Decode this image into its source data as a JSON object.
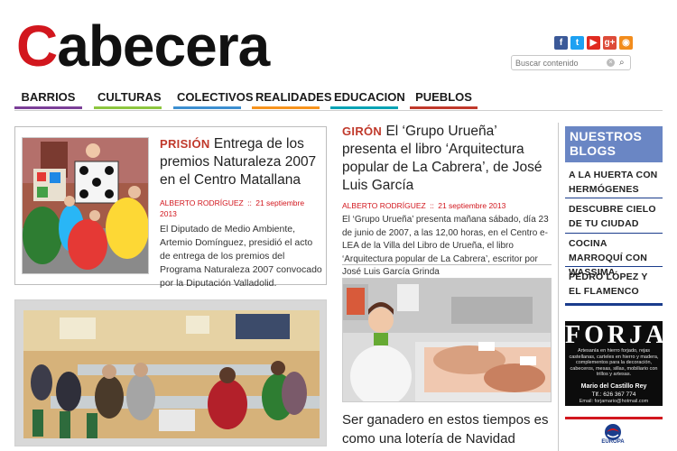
{
  "site": {
    "logo_first": "C",
    "logo_rest": "abecera"
  },
  "social": [
    {
      "name": "facebook-icon",
      "glyph": "f",
      "color": "#3b5998"
    },
    {
      "name": "twitter-icon",
      "glyph": "t",
      "color": "#1da1f2"
    },
    {
      "name": "youtube-icon",
      "glyph": "▶",
      "color": "#e02a20"
    },
    {
      "name": "google-plus-icon",
      "glyph": "g+",
      "color": "#dd4b39"
    },
    {
      "name": "rss-icon",
      "glyph": "◉",
      "color": "#f28c1c"
    }
  ],
  "search": {
    "placeholder": "Buscar contenido"
  },
  "nav": [
    {
      "label": "BARRIOS",
      "color": "#7b3f98"
    },
    {
      "label": "CULTURAS",
      "color": "#8dc63f"
    },
    {
      "label": "COLECTIVOS",
      "color": "#3d8fd1"
    },
    {
      "label": "REALIDADES",
      "color": "#f7941d"
    },
    {
      "label": "EDUCACION",
      "color": "#00a3b4"
    },
    {
      "label": "PUEBLOS",
      "color": "#c0392b"
    }
  ],
  "article1": {
    "kicker": "PRISIÓN",
    "title": "Entrega de los premios Naturaleza 2007 en el Centro Matallana",
    "author": "ALBERTO RODRÍGUEZ",
    "sep": "::",
    "date": "21 septiembre 2013",
    "excerpt": "El Diputado de Medio Ambiente, Artemio Domínguez, presidió el acto de entrega de los premios del Programa Naturaleza 2007 convocado por la Diputación Valladolid."
  },
  "article2": {
    "kicker": "GIRÓN",
    "title": "El ‘Grupo Urueña’ presenta el libro ‘Arquitectura popular de La Cabrera’, de José Luis García",
    "author": "ALBERTO RODRÍGUEZ",
    "sep": "::",
    "date": "21 septiembre 2013",
    "excerpt": "El ‘Grupo Urueña’ presenta mañana sábado, día 23 de junio de 2007, a las 12,00 horas, en el Centro e-LEA de la Villa del Libro de Urueña, el libro ‘Arquitectura popular de La Cabrera’, escritor por José Luis García Grinda"
  },
  "article3": {
    "title": "Ser ganadero en estos tiempos  es como una lotería de Navidad"
  },
  "blogs": {
    "title": "NUESTROS BLOGS",
    "items": [
      "A LA HUERTA CON HERMÓGENES",
      "DESCUBRE CIELO DE TU CIUDAD",
      "COCINA MARROQUÍ CON WASSIMA",
      "PEDRO LÓPEZ Y EL FLAMENCO"
    ]
  },
  "forja": {
    "title": "FORJA",
    "description": "Artesanía en hierro forjado, rejas castellanas, carteles en hierro y madera, complementos para la decoración, cabeceros, mesas, sillas, mobiliario con trillos y artesas.",
    "name": "Mario del Castillo Rey",
    "tel": "Tlf.: 626 367 774",
    "email": "Email: forjamario@hotmail.com"
  },
  "europa": {
    "label": "EUROPA"
  }
}
